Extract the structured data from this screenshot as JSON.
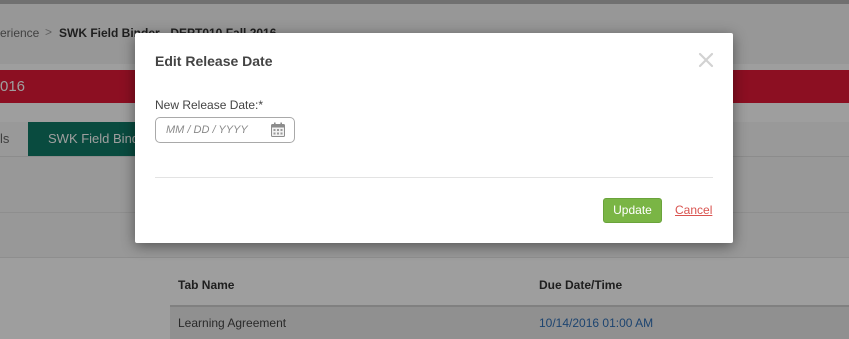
{
  "background": {
    "breadcrumb": {
      "parent": "erience",
      "separator": ">",
      "current": "SWK Field Binder - DEPT010 Fall 2016"
    },
    "course_bar": {
      "text": "016"
    },
    "tabs": [
      {
        "label": "ls"
      },
      {
        "label": "SWK Field Binder"
      }
    ],
    "table": {
      "columns": [
        "Tab Name",
        "Due Date/Time"
      ],
      "rows": [
        {
          "tab_name": "Learning Agreement",
          "due": "10/14/2016 01:00 AM"
        }
      ]
    }
  },
  "modal": {
    "title": "Edit Release Date",
    "field_label": "New Release Date:*",
    "date_placeholder": "MM / DD / YYYY",
    "date_value": "",
    "update_label": "Update",
    "cancel_label": "Cancel",
    "icons": {
      "close": "close-icon",
      "calendar": "calendar-icon"
    }
  },
  "colors": {
    "accent_red": "#e31937",
    "tab_green": "#0f7a66",
    "update_green": "#7ab545",
    "cancel_red": "#d9534f",
    "link_blue": "#2f6fb5"
  }
}
